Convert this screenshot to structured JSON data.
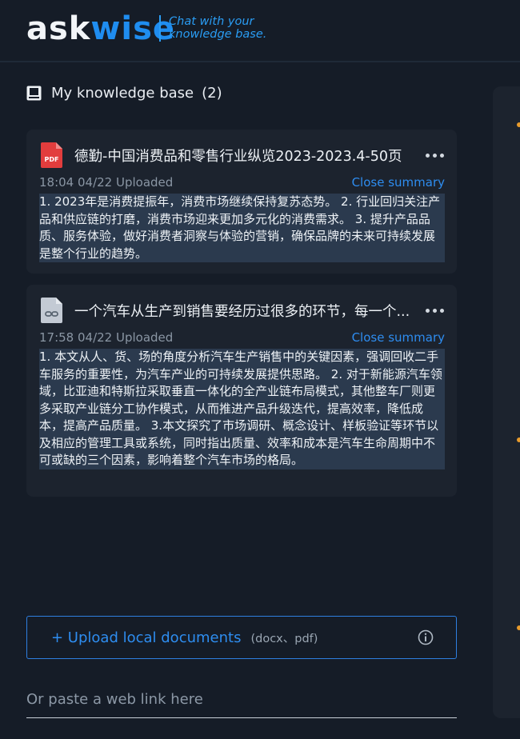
{
  "brand": {
    "logo_prefix": "ask",
    "logo_suffix": "wise",
    "tagline_line1": "Chat with your",
    "tagline_line2": "knowledge base.",
    "accent_color": "#1f8df0"
  },
  "knowledge_base": {
    "title": "My knowledge base",
    "count": "(2)"
  },
  "documents": [
    {
      "icon": "pdf-file-icon",
      "title": "德勤-中国消费品和零售行业纵览2023-2023.4-50页",
      "meta": "18:04 04/22 Uploaded",
      "action": "Close summary",
      "summary": "1. 2023年是消费提振年，消费市场继续保持复苏态势。 2. 行业回归关注产品和供应链的打磨，消费市场迎来更加多元化的消费需求。 3. 提升产品品质、服务体验，做好消费者洞察与体验的营销，确保品牌的未来可持续发展是整个行业的趋势。"
    },
    {
      "icon": "link-file-icon",
      "title": "一个汽车从生产到销售要经历过很多的环节，每一个...",
      "meta": "17:58 04/22 Uploaded",
      "action": "Close summary",
      "summary": "1. 本文从人、货、场的角度分析汽车生产销售中的关键因素，强调回收二手车服务的重要性，为汽车产业的可持续发展提供思路。 2. 对于新能源汽车领域，比亚迪和特斯拉采取垂直一体化的全产业链布局模式，其他整车厂则更多采取产业链分工协作模式，从而推进产品升级迭代，提高效率，降低成本，提高产品质量。 3.本文探究了市场调研、概念设计、样板验证等环节以及相应的管理工具或系统，同时指出质量、效率和成本是汽车生命周期中不可或缺的三个因素，影响着整个汽车市场的格局。"
    }
  ],
  "upload": {
    "label": "+ Upload local documents",
    "hint": "(docx、pdf)"
  },
  "paste_link": {
    "placeholder": "Or paste a web link here",
    "value": ""
  }
}
